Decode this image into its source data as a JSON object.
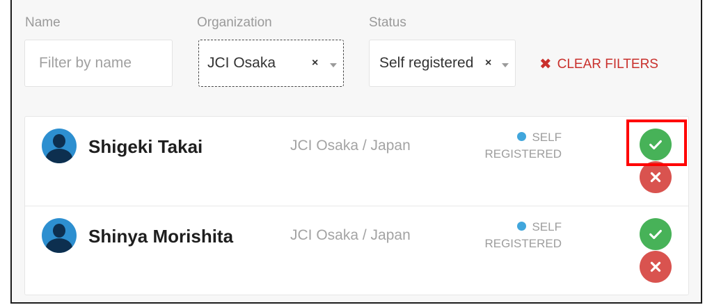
{
  "filters": {
    "name_label": "Name",
    "name_placeholder": "Filter by name",
    "org_label": "Organization",
    "org_value": "JCI Osaka",
    "status_label": "Status",
    "status_value": "Self registered",
    "remove_symbol": "×",
    "clear_label": "CLEAR FILTERS",
    "clear_symbol": "✖"
  },
  "people": [
    {
      "name": "Shigeki Takai",
      "org": "JCI Osaka / Japan",
      "status_line1": "SELF",
      "status_line2": "REGISTERED"
    },
    {
      "name": "Shinya Morishita",
      "org": "JCI Osaka / Japan",
      "status_line1": "SELF",
      "status_line2": "REGISTERED"
    }
  ],
  "colors": {
    "approve": "#47b258",
    "reject": "#d9534f",
    "accent_red": "#c9302c",
    "status_dot": "#41a6dc",
    "highlight": "#ff0000"
  },
  "icons": [
    "user-avatar-icon",
    "check-icon",
    "close-icon",
    "chevron-down-icon"
  ]
}
